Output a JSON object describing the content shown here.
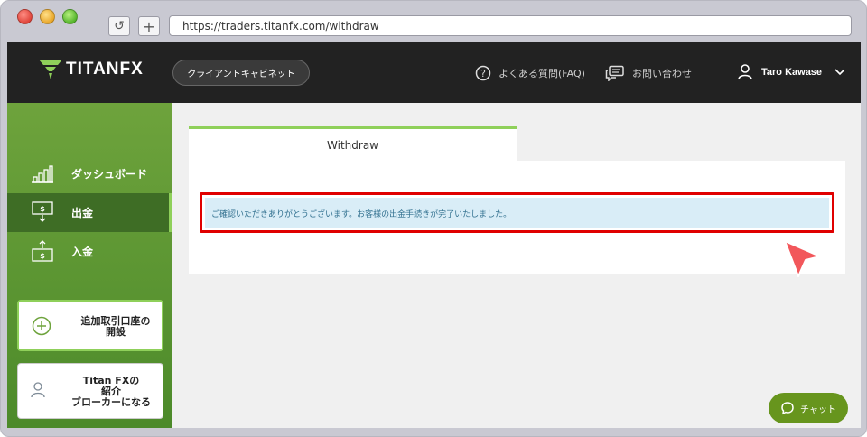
{
  "browser": {
    "url": "https://traders.titanfx.com/withdraw",
    "reload_glyph": "↺",
    "newtab_glyph": "+"
  },
  "header": {
    "logo_text": "TITANFX",
    "cabinet_label": "クライアントキャビネット",
    "faq_label": "よくある質問(FAQ)",
    "contact_label": "お問い合わせ",
    "user_name": "Taro Kawase",
    "icons": [
      "question-circle-icon",
      "chat-bubbles-icon",
      "person-icon",
      "chevron-down-icon"
    ]
  },
  "sidebar": {
    "items": [
      {
        "label": "ダッシュボード",
        "icon": "bar-chart-icon"
      },
      {
        "label": "出金",
        "icon": "withdraw-icon",
        "active": true
      },
      {
        "label": "入金",
        "icon": "deposit-icon"
      }
    ],
    "open_account": {
      "line1": "追加取引口座の",
      "line2": "開設",
      "icon": "plus-circle-icon"
    },
    "refer": {
      "line1": "Titan FXの",
      "line2": "紹介",
      "line3": "ブローカーになる",
      "icon": "person-icon"
    }
  },
  "main": {
    "tab_label": "Withdraw",
    "alert_message": "ご確認いただきありがとうございます。お客様の出金手続きが完了いたしました。"
  },
  "chat": {
    "label": "チャット",
    "icon": "chat-icon"
  },
  "colors": {
    "brand_green": "#8fd05a",
    "sidebar_green": "#5e9834",
    "header_dark": "#222222",
    "alert_bg": "#d9edf7",
    "alert_text": "#31708f",
    "highlight_red": "#e00000",
    "chat_green": "#67951d"
  }
}
